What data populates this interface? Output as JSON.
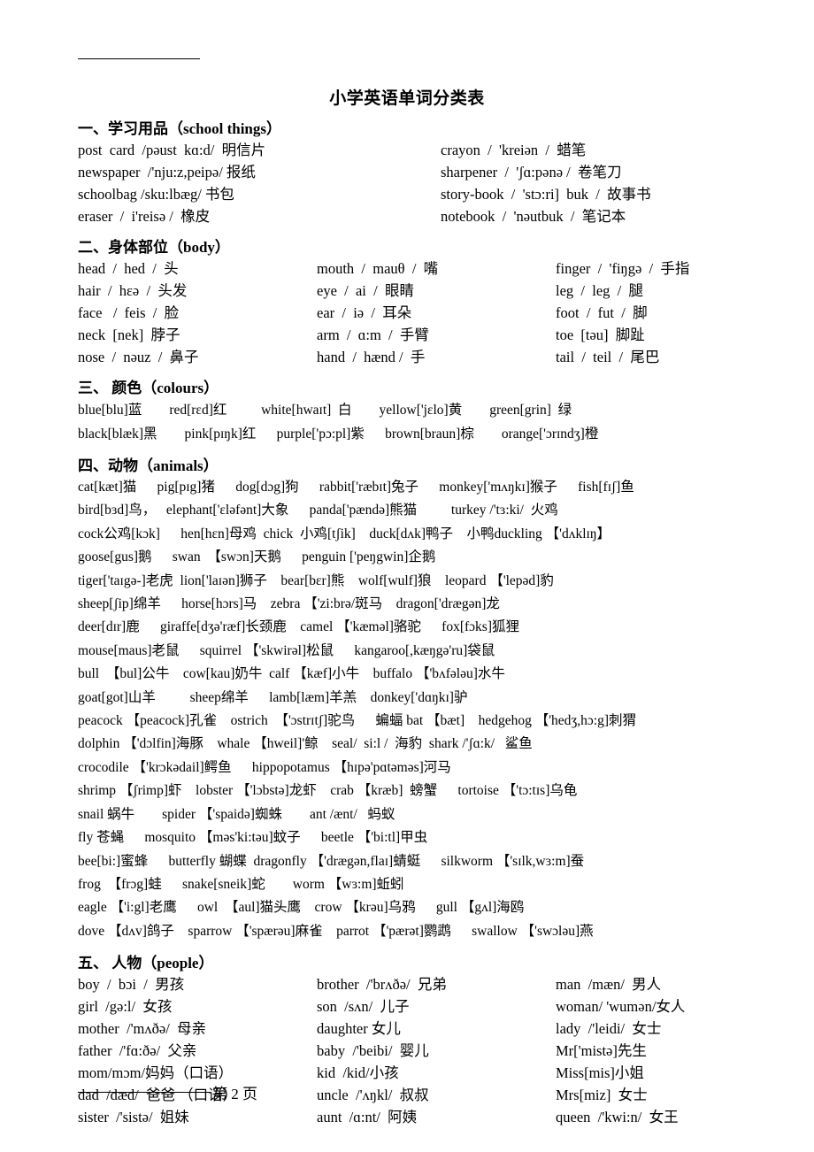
{
  "document": {
    "title": "小学英语单词分类表",
    "footer_page": "第  2  页"
  },
  "sections": {
    "school_things": {
      "heading": "一、学习用品（school  things）",
      "rows": [
        [
          "post  card  /pəust  kɑ:d/  明信片",
          "crayon  /  'kreiən  /  蜡笔"
        ],
        [
          "newspaper  /'nju:z,peipə/ 报纸",
          "sharpener  /  'ʃɑ:pənə /  卷笔刀"
        ],
        [
          "schoolbag /sku:lbæg/ 书包",
          "story-book  /  'stɔ:ri]  buk  /  故事书"
        ],
        [
          "eraser  /  i'reisə /  橡皮",
          "notebook  /  'nəutbuk  /  笔记本"
        ]
      ]
    },
    "body": {
      "heading": "二、身体部位（body）",
      "rows": [
        [
          "head  /  hed  /  头",
          "mouth  /  mauθ  /  嘴",
          "finger  /  'fiŋgə  /  手指"
        ],
        [
          "hair  /  hɛə  /  头发",
          "eye  /  ai  /  眼睛",
          "leg  /  leg  /  腿"
        ],
        [
          "face   /  feis  /  脸",
          "ear  /  iə  /  耳朵",
          "foot  /  fut  /  脚"
        ],
        [
          "neck  [nek]  脖子",
          "arm  /  ɑ:m  /  手臂",
          "toe  [təu]  脚趾"
        ],
        [
          "nose  /  nəuz  /  鼻子",
          "hand  /  hænd /  手",
          "tail  /  teil  /  尾巴"
        ]
      ]
    },
    "colours": {
      "heading": "三、  颜色（colours）",
      "lines": [
        "blue[blu]蓝        red[rɛd]红          white[hwaɪt]  白        yellow['jɛlo]黄        green[grin]  绿",
        "black[blæk]黑        pink[pɪŋk]红      purple['pɔ:pl]紫      brown[braun]棕        orange['ɔrɪndʒ]橙"
      ]
    },
    "animals": {
      "heading": "四、动物（animals）",
      "lines": [
        "cat[kæt]猫      pig[pɪg]猪      dog[dɔg]狗      rabbit['ræbɪt]兔子      monkey['mʌŋkɪ]猴子      fish[fɪʃ]鱼",
        "bird[bɜd]鸟，   elephant['ɛləfənt]大象      panda['pændə]熊猫          turkey /'tɜ:ki/  火鸡",
        "cock公鸡[kɔk]      hen[hɛn]母鸡  chick  小鸡[tʃik]    duck[dʌk]鸭子    小鸭duckling 【'dʌklɪŋ】",
        "goose[gus]鹅      swan  【swɔn]天鹅      penguin ['peŋgwin]企鹅",
        "tiger['taɪgə-]老虎  lion['laɪən]狮子    bear[bɛr]熊    wolf[wulf]狼    leopard 【'lepəd]豹",
        "sheep[ʃip]绵羊      horse[hɔrs]马    zebra 【'zi:brə/斑马    dragon['drægən]龙",
        "deer[dɪr]鹿      giraffe[dʒə'ræf]长颈鹿    camel 【'kæməl]骆驼      fox[fɔks]狐狸",
        "mouse[maus]老鼠      squirrel 【'skwirəl]松鼠      kangaroo[,kæŋgə'ru]袋鼠",
        "bull  【bul]公牛    cow[kau]奶牛  calf 【kæf]小牛    buffalo 【'bʌfələu]水牛",
        "goat[got]山羊          sheep绵羊      lamb[læm]羊羔    donkey['dɑŋkɪ]驴",
        "peacock 【peacock]孔雀    ostrich  【'ɔstrɪtʃ]驼鸟      蝙蝠 bat 【bæt]    hedgehog 【'hedʒ,hɔ:g]刺猬",
        "dolphin 【'dɔlfin]海豚    whale 【hweil]'鲸    seal/  si:l /  海豹  shark /'ʃɑ:k/   鲨鱼",
        "crocodile 【'krɔkədail]鳄鱼      hippopotamus 【hɪpə'pɑtəməs]河马",
        "shrimp 【ʃrimp]虾    lobster 【'lɔbstə]龙虾    crab 【kræb]  螃蟹      tortoise 【'tɔ:tɪs]乌龟",
        "snail 蜗牛        spider 【'spaidə]蜘蛛        ant /ænt/   蚂蚁",
        "fly 苍蝇      mosquito 【məs'ki:təu]蚊子      beetle 【'bi:tl]甲虫",
        "bee[bi:]蜜蜂      butterfly 蝴蝶  dragonfly 【'drægən,flaɪ]蜻蜓      silkworm 【'sɪlk,wɜ:m]蚕",
        "frog  【frɔg]蛙      snake[sneik]蛇        worm 【wɜ:m]蚯蚓",
        "eagle 【'i:gl]老鹰      owl  【aul]猫头鹰    crow 【krəu]乌鸦      gull 【gʌl]海鸥",
        "dove 【dʌv]鸽子    sparrow 【'spærəu]麻雀    parrot 【'pærət]鹦鹉      swallow 【'swɔləu]燕"
      ]
    },
    "people": {
      "heading": "五、  人物（people）",
      "rows": [
        [
          "boy  /  bɔi  /  男孩",
          "brother  /'brʌðə/  兄弟",
          "man  /mæn/  男人"
        ],
        [
          "girl  /gə:l/  女孩",
          "son  /sʌn/  儿子",
          "woman/ 'wumən/女人"
        ],
        [
          "mother  /'mʌðə/  母亲",
          "daughter 女儿",
          "lady  /'leidi/  女士"
        ],
        [
          "father  /'fɑ:ðə/  父亲",
          "baby  /'beibi/  婴儿",
          "Mr['mistə]先生"
        ],
        [
          "mom/mɔm/妈妈（口语）",
          "kid  /kid/小孩",
          "Miss[mis]小姐"
        ],
        [
          "dad  /dæd/  爸爸 （口语）",
          "uncle  /'ʌŋkl/  叔叔",
          "Mrs[miz]  女士"
        ],
        [
          "sister  /'sistə/  姐妹",
          "aunt  /ɑ:nt/  阿姨",
          "queen  /'kwi:n/  女王"
        ]
      ]
    }
  }
}
